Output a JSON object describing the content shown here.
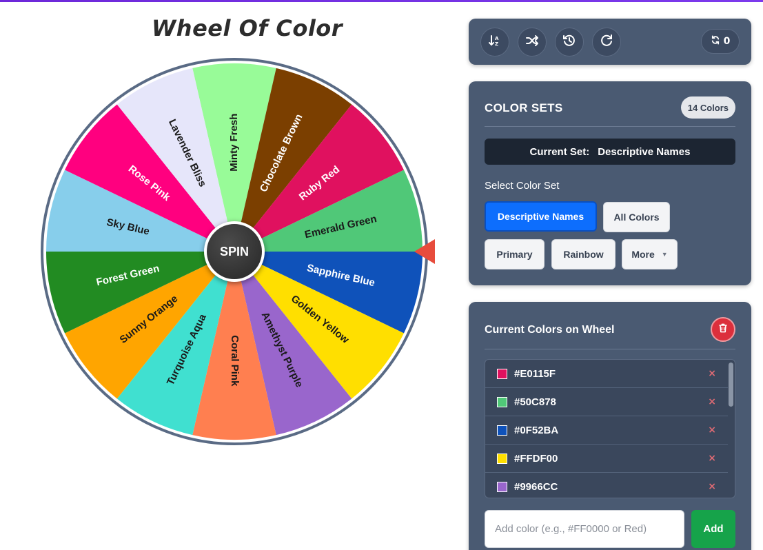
{
  "app": {
    "title": "Wheel Of Color"
  },
  "wheel": {
    "spin_label": "SPIN",
    "segments": [
      {
        "label": "Minty Fresh",
        "color": "#98FB98",
        "text_color": "#1a1a1a"
      },
      {
        "label": "Chocolate Brown",
        "color": "#7B3F00",
        "text_color": "#ffffff"
      },
      {
        "label": "Ruby Red",
        "color": "#E0115F",
        "text_color": "#ffffff"
      },
      {
        "label": "Emerald Green",
        "color": "#50C878",
        "text_color": "#1a1a1a"
      },
      {
        "label": "Sapphire Blue",
        "color": "#0F52BA",
        "text_color": "#ffffff"
      },
      {
        "label": "Golden Yellow",
        "color": "#FFDF00",
        "text_color": "#1a1a1a"
      },
      {
        "label": "Amethyst Purple",
        "color": "#9966CC",
        "text_color": "#1a1a1a"
      },
      {
        "label": "Coral Pink",
        "color": "#FF7F50",
        "text_color": "#1a1a1a"
      },
      {
        "label": "Turquoise Aqua",
        "color": "#40E0D0",
        "text_color": "#1a1a1a"
      },
      {
        "label": "Sunny Orange",
        "color": "#FFA500",
        "text_color": "#1a1a1a"
      },
      {
        "label": "Forest Green",
        "color": "#228B22",
        "text_color": "#ffffff"
      },
      {
        "label": "Sky Blue",
        "color": "#87CEEB",
        "text_color": "#1a1a1a"
      },
      {
        "label": "Rose Pink",
        "color": "#FF007F",
        "text_color": "#ffffff"
      },
      {
        "label": "Lavender Bliss",
        "color": "#E6E6FA",
        "text_color": "#1a1a1a"
      }
    ],
    "pointer_color": "#E74C3C",
    "rim_color": "#5a6b85"
  },
  "toolbar": {
    "sort_icon": "sort-icon",
    "shuffle_icon": "shuffle-icon",
    "history_icon": "history-icon",
    "redo_icon": "redo-icon",
    "spin_count": "0"
  },
  "color_sets": {
    "title": "COLOR SETS",
    "badge": "14 Colors",
    "current_set_label": "Current Set:",
    "current_set_value": "Descriptive Names",
    "select_label": "Select Color Set",
    "buttons": {
      "descriptive": "Descriptive Names",
      "all": "All Colors",
      "primary": "Primary",
      "rainbow": "Rainbow",
      "more": "More"
    }
  },
  "current_colors": {
    "title": "Current Colors on Wheel",
    "items": [
      {
        "hex": "#E0115F"
      },
      {
        "hex": "#50C878"
      },
      {
        "hex": "#0F52BA"
      },
      {
        "hex": "#FFDF00"
      },
      {
        "hex": "#9966CC"
      }
    ],
    "remove_symbol": "×",
    "input_placeholder": "Add color (e.g., #FF0000 or Red)",
    "add_label": "Add"
  },
  "accent_colors": {
    "primary_button": "#0d6efd",
    "add_button": "#16a34a",
    "delete_button": "#dc2f3c",
    "panel": "#4a5a72"
  }
}
